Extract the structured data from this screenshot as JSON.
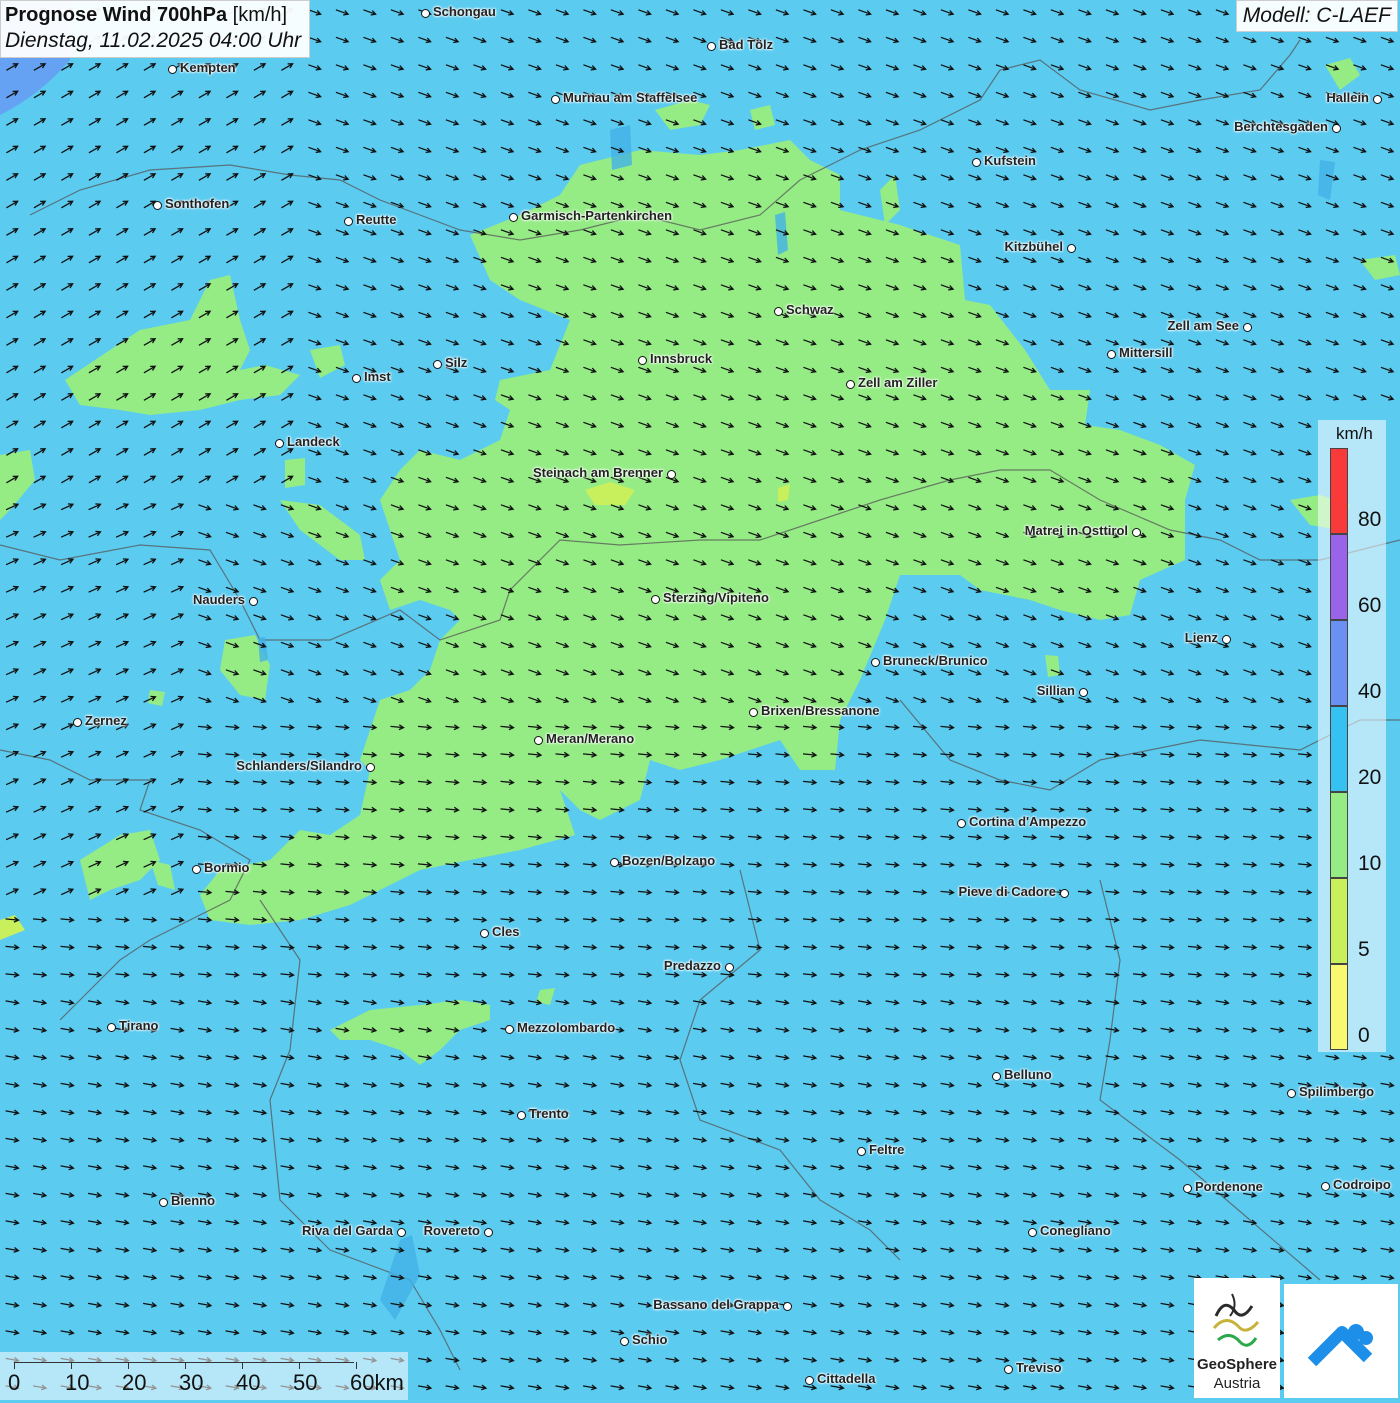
{
  "title": {
    "main": "Prognose Wind 700hPa",
    "unit": "[km/h]",
    "date": "Dienstag, 11.02.2025 04:00 Uhr"
  },
  "model": "Modell: C-LAEF",
  "colors": {
    "background_speed": "#5bcbf0",
    "wind_10_20": "#95ec85",
    "wind_5_10": "#c8ef5c",
    "wind_0_5": "#f9f871"
  },
  "legend": {
    "unit": "km/h",
    "ticks": [
      "80",
      "60",
      "40",
      "20",
      "10",
      "5",
      "0"
    ],
    "bands": [
      {
        "color": "#f93a3a"
      },
      {
        "color": "#9a64ea"
      },
      {
        "color": "#6a90f3"
      },
      {
        "color": "#35c1f1"
      },
      {
        "color": "#95ec85"
      },
      {
        "color": "#c8ef5c"
      },
      {
        "color": "#f9f871"
      }
    ]
  },
  "cities": [
    {
      "name": "Schongau"
    },
    {
      "name": "Bad Tölz"
    },
    {
      "name": "Kempten"
    },
    {
      "name": "Murnau am Staffelsee"
    },
    {
      "name": "Hallein"
    },
    {
      "name": "Berchtesgaden"
    },
    {
      "name": "Kufstein"
    },
    {
      "name": "Sonthofen"
    },
    {
      "name": "Reutte"
    },
    {
      "name": "Garmisch-Partenkirchen"
    },
    {
      "name": "Kitzbühel"
    },
    {
      "name": "Schwaz"
    },
    {
      "name": "Zell am See"
    },
    {
      "name": "Mittersill"
    },
    {
      "name": "Innsbruck"
    },
    {
      "name": "Silz"
    },
    {
      "name": "Imst"
    },
    {
      "name": "Zell am Ziller"
    },
    {
      "name": "Landeck"
    },
    {
      "name": "Steinach am Brenner"
    },
    {
      "name": "Matrei in Osttirol"
    },
    {
      "name": "Nauders"
    },
    {
      "name": "Sterzing/Vipiteno"
    },
    {
      "name": "Lienz"
    },
    {
      "name": "Bruneck/Brunico"
    },
    {
      "name": "Sillian"
    },
    {
      "name": "Brixen/Bressanone"
    },
    {
      "name": "Zernez"
    },
    {
      "name": "Meran/Merano"
    },
    {
      "name": "Schlanders/Silandro"
    },
    {
      "name": "Cortina d'Ampezzo"
    },
    {
      "name": "Bozen/Bolzano"
    },
    {
      "name": "Bormio"
    },
    {
      "name": "Pieve di Cadore"
    },
    {
      "name": "Cles"
    },
    {
      "name": "Predazzo"
    },
    {
      "name": "Tirano"
    },
    {
      "name": "Mezzolombardo"
    },
    {
      "name": "Belluno"
    },
    {
      "name": "Spilimbergo"
    },
    {
      "name": "Trento"
    },
    {
      "name": "Feltre"
    },
    {
      "name": "Pordenone"
    },
    {
      "name": "Codroipo"
    },
    {
      "name": "Bienno"
    },
    {
      "name": "Riva del Garda"
    },
    {
      "name": "Rovereto"
    },
    {
      "name": "Conegliano"
    },
    {
      "name": "Bassano del Grappa"
    },
    {
      "name": "Schio"
    },
    {
      "name": "Treviso"
    },
    {
      "name": "Cittadella"
    }
  ],
  "scale_bar": {
    "labels": [
      "0",
      "10",
      "20",
      "30",
      "40",
      "50",
      "60km"
    ]
  },
  "logos": {
    "geosphere_line1": "GeoSphere",
    "geosphere_line2": "Austria"
  }
}
